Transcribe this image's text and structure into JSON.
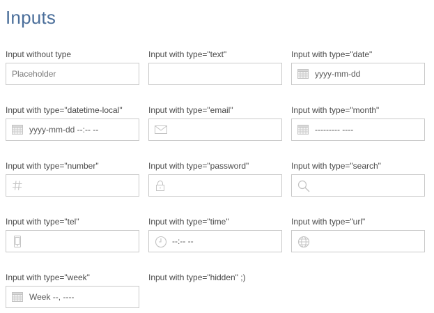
{
  "page": {
    "title": "Inputs"
  },
  "fields": {
    "no_type": {
      "label": "Input without type",
      "placeholder": "Placeholder"
    },
    "text": {
      "label": "Input with type=\"text\"",
      "value": ""
    },
    "date": {
      "label": "Input with type=\"date\"",
      "value": "yyyy-mm-dd",
      "icon": "calendar-icon"
    },
    "datetime_local": {
      "label": "Input with type=\"datetime-local\"",
      "value": "yyyy-mm-dd --:-- --",
      "icon": "calendar-icon"
    },
    "email": {
      "label": "Input with type=\"email\"",
      "value": "",
      "icon": "envelope-icon"
    },
    "month": {
      "label": "Input with type=\"month\"",
      "value": "--------- ----",
      "icon": "calendar-icon"
    },
    "number": {
      "label": "Input with type=\"number\"",
      "value": "",
      "icon": "hash-icon"
    },
    "password": {
      "label": "Input with type=\"password\"",
      "value": "",
      "icon": "lock-icon"
    },
    "search": {
      "label": "Input with type=\"search\"",
      "value": "",
      "icon": "search-icon"
    },
    "tel": {
      "label": "Input with type=\"tel\"",
      "value": "",
      "icon": "phone-icon"
    },
    "time": {
      "label": "Input with type=\"time\"",
      "value": "--:-- --",
      "icon": "clock-icon"
    },
    "url": {
      "label": "Input with type=\"url\"",
      "value": "",
      "icon": "globe-icon"
    },
    "week": {
      "label": "Input with type=\"week\"",
      "value": "Week --, ----",
      "icon": "calendar-icon"
    },
    "hidden": {
      "label": "Input with type=\"hidden\" ;)"
    }
  },
  "colors": {
    "title": "#4a6e9a",
    "border": "#c9c9c9",
    "icon": "#c4c4c4",
    "text": "#4a4a4a"
  }
}
